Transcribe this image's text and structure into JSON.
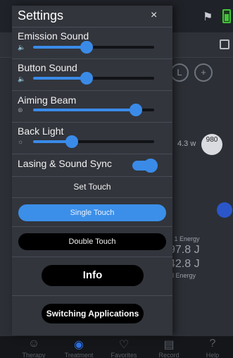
{
  "background_app": {
    "right_value_small": "4.3 w",
    "right_value_circle": "980",
    "energy": [
      "e 1 Energy",
      "97.8 J",
      "42.8 J",
      "al Energy"
    ],
    "nav": [
      {
        "label": "Therapy",
        "icon": "head-icon"
      },
      {
        "label": "Treatment",
        "icon": "target-icon"
      },
      {
        "label": "Favorites",
        "icon": "heart-icon"
      },
      {
        "label": "Record",
        "icon": "clipboard-icon"
      },
      {
        "label": "Help",
        "icon": "help-icon"
      }
    ]
  },
  "settings": {
    "title": "Settings",
    "close_label": "×",
    "sliders": [
      {
        "label": "Emission Sound",
        "icon": "speaker-icon",
        "level": 0.44
      },
      {
        "label": "Button Sound",
        "icon": "speaker-icon",
        "level": 0.44
      },
      {
        "label": "Aiming Beam",
        "icon": "beam-icon",
        "level": 0.85
      },
      {
        "label": "Back Light",
        "icon": "sun-icon",
        "level": 0.32
      }
    ],
    "toggle": {
      "label": "Lasing & Sound Sync",
      "on": true
    },
    "set_touch_label": "Set Touch",
    "single_touch_label": "Single Touch",
    "double_touch_label": "Double Touch",
    "info_label": "Info",
    "switch_label": "Switching Applications",
    "accent_color": "#3a8be8"
  }
}
